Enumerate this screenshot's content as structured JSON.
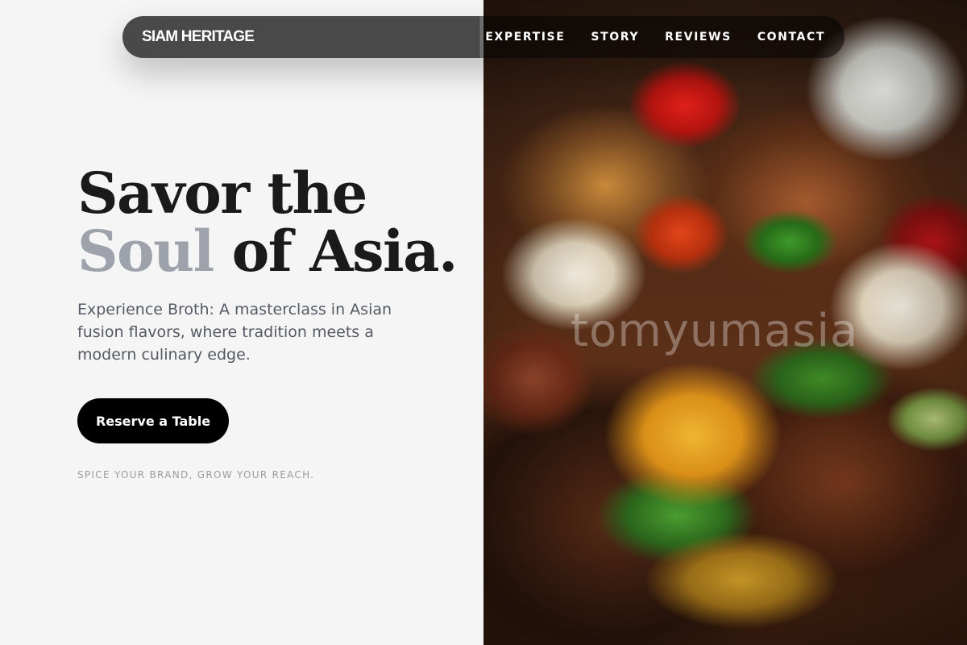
{
  "navbar": {
    "brand": "SIAM HERITAGE",
    "links": [
      {
        "label": "EXPERTISE"
      },
      {
        "label": "STORY"
      },
      {
        "label": "REVIEWS"
      },
      {
        "label": "CONTACT"
      }
    ]
  },
  "hero": {
    "headline_line1": "Savor the",
    "headline_soft": "Soul",
    "headline_rest": " of Asia.",
    "lead": "Experience Broth: A masterclass in Asian fusion flavors, where tradition meets a modern culinary edge.",
    "cta_label": "Reserve a Table",
    "tagline": "SPICE YOUR BRAND, GROW YOUR REACH."
  },
  "image": {
    "watermark": "tomyumasia"
  }
}
